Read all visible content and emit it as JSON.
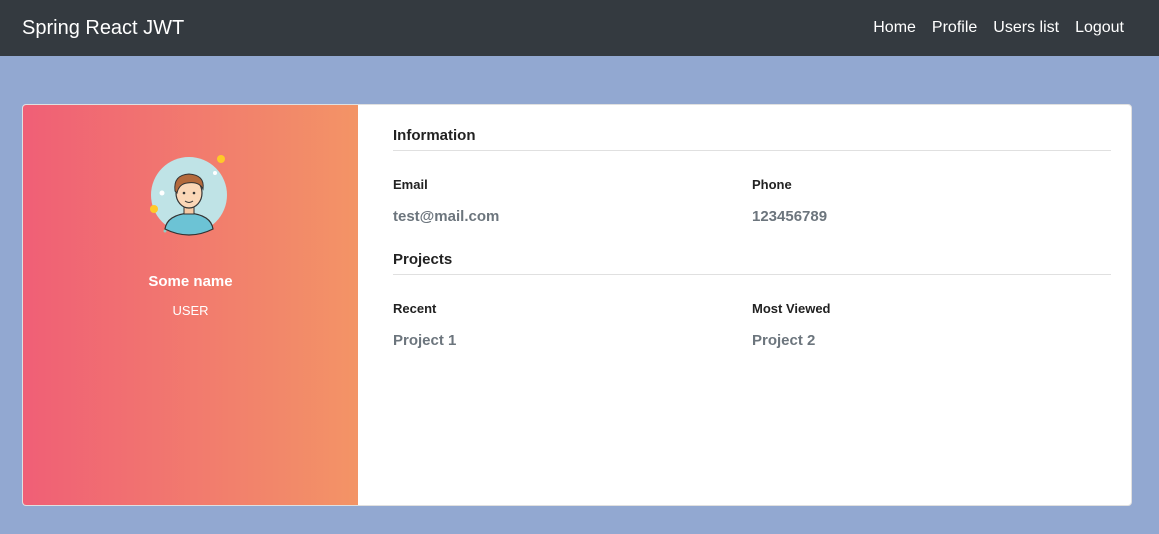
{
  "navbar": {
    "brand": "Spring React JWT",
    "links": [
      "Home",
      "Profile",
      "Users list",
      "Logout"
    ]
  },
  "profile": {
    "name": "Some name",
    "role": "USER",
    "avatar_icon": "user-avatar-icon"
  },
  "information": {
    "title": "Information",
    "email_label": "Email",
    "email": "test@mail.com",
    "phone_label": "Phone",
    "phone": "123456789"
  },
  "projects": {
    "title": "Projects",
    "recent_label": "Recent",
    "recent": "Project 1",
    "most_viewed_label": "Most Viewed",
    "most_viewed": "Project 2"
  },
  "colors": {
    "navbar": "#343a40",
    "background": "#92a8d1",
    "gradient_start": "#f05f76",
    "gradient_end": "#f39466"
  }
}
